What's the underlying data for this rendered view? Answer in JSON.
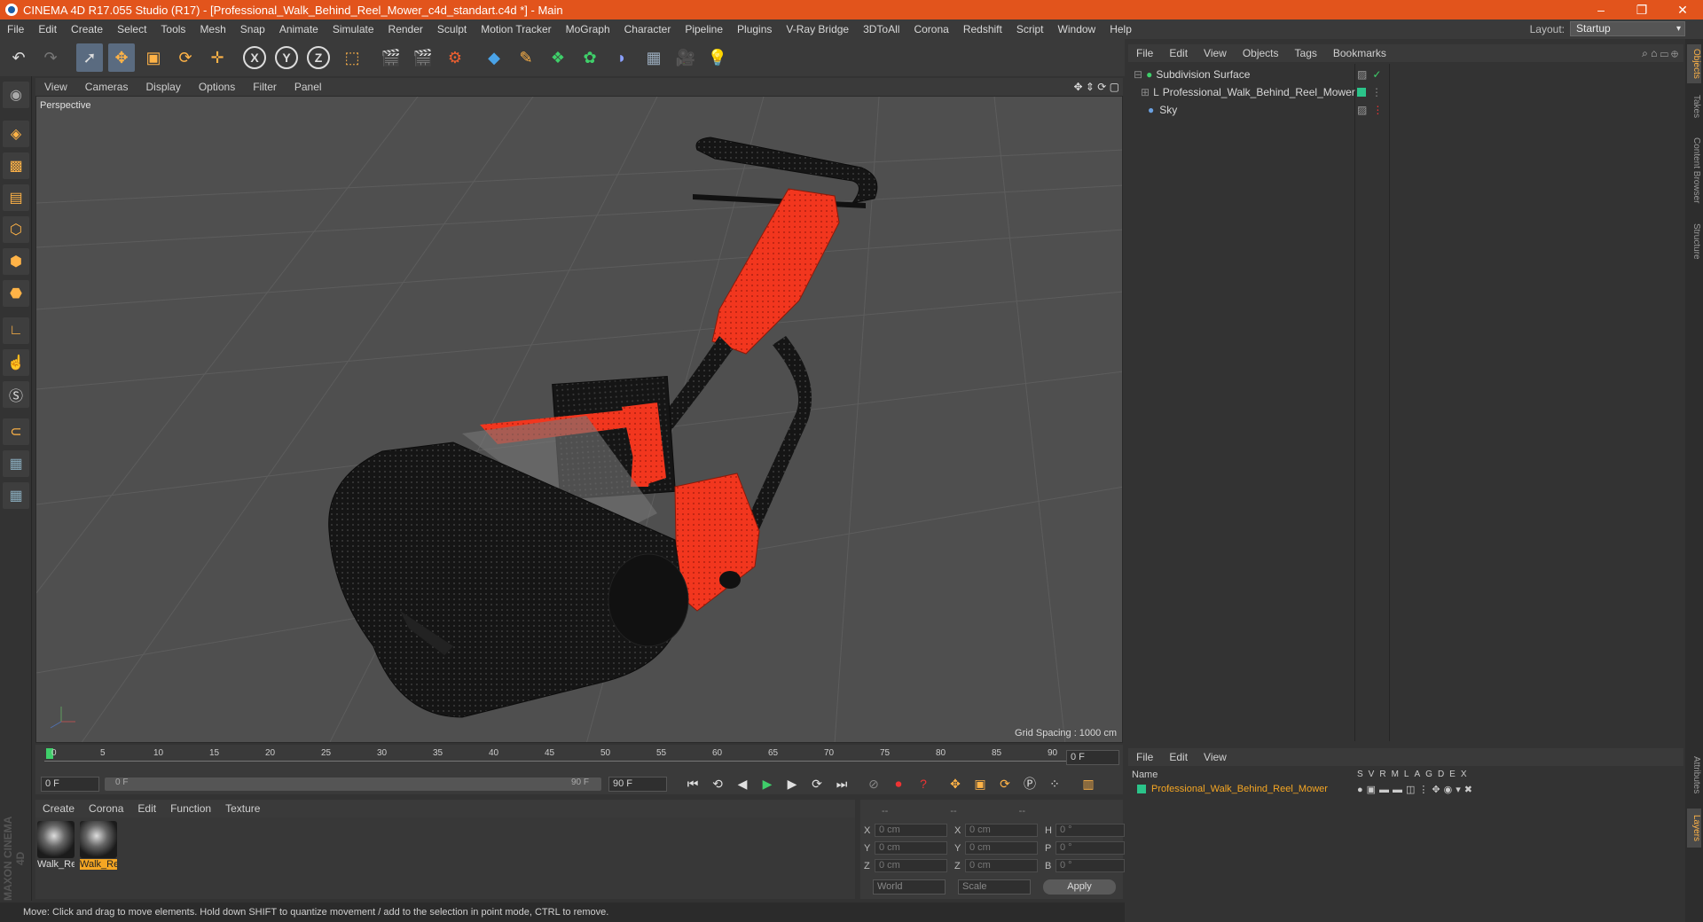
{
  "titlebar": {
    "title": "CINEMA 4D R17.055 Studio (R17) - [Professional_Walk_Behind_Reel_Mower_c4d_standart.c4d *] - Main"
  },
  "menubar": {
    "items": [
      "File",
      "Edit",
      "Create",
      "Select",
      "Tools",
      "Mesh",
      "Snap",
      "Animate",
      "Simulate",
      "Render",
      "Sculpt",
      "Motion Tracker",
      "MoGraph",
      "Character",
      "Pipeline",
      "Plugins",
      "V-Ray Bridge",
      "3DToAll",
      "Corona",
      "Redshift",
      "Script",
      "Window",
      "Help"
    ],
    "layout_label": "Layout:",
    "layout_value": "Startup"
  },
  "viewport": {
    "menu": [
      "View",
      "Cameras",
      "Display",
      "Options",
      "Filter",
      "Panel"
    ],
    "label": "Perspective",
    "grid_spacing": "Grid Spacing : 1000 cm"
  },
  "timeline": {
    "ticks": [
      "0",
      "5",
      "10",
      "15",
      "20",
      "25",
      "30",
      "35",
      "40",
      "45",
      "50",
      "55",
      "60",
      "65",
      "70",
      "75",
      "80",
      "85",
      "90"
    ],
    "current_frame": "0 F",
    "start_field": "0 F",
    "slider_start": "0 F",
    "slider_end": "90 F",
    "end_field": "90 F"
  },
  "materials": {
    "menu": [
      "Create",
      "Corona",
      "Edit",
      "Function",
      "Texture"
    ],
    "items": [
      {
        "name": "Walk_Re"
      },
      {
        "name": "Walk_Re"
      }
    ]
  },
  "coordinates": {
    "header": [
      "--",
      "--",
      "--"
    ],
    "rows": [
      {
        "a": "X",
        "av": "0 cm",
        "b": "X",
        "bv": "0 cm",
        "c": "H",
        "cv": "0 °"
      },
      {
        "a": "Y",
        "av": "0 cm",
        "b": "Y",
        "bv": "0 cm",
        "c": "P",
        "cv": "0 °"
      },
      {
        "a": "Z",
        "av": "0 cm",
        "b": "Z",
        "bv": "0 cm",
        "c": "B",
        "cv": "0 °"
      }
    ],
    "mode1": "World",
    "mode2": "Scale",
    "apply": "Apply"
  },
  "object_manager": {
    "menu": [
      "File",
      "Edit",
      "View",
      "Objects",
      "Tags",
      "Bookmarks"
    ],
    "objects": [
      {
        "name": "Subdivision Surface"
      },
      {
        "name": "Professional_Walk_Behind_Reel_Mower"
      },
      {
        "name": "Sky"
      }
    ]
  },
  "layer_manager": {
    "menu": [
      "File",
      "Edit",
      "View"
    ],
    "name_header": "Name",
    "cols": [
      "S",
      "V",
      "R",
      "M",
      "L",
      "A",
      "G",
      "D",
      "E",
      "X"
    ],
    "layer_name": "Professional_Walk_Behind_Reel_Mower",
    "layer_color": "#2bc48a"
  },
  "right_tabs": [
    "Objects",
    "Takes",
    "Content Browser",
    "Structure",
    "Attributes",
    "Layers"
  ],
  "status": "Move: Click and drag to move elements. Hold down SHIFT to quantize movement / add to the selection in point mode, CTRL to remove.",
  "brand": "MAXON CINEMA 4D",
  "colors": {
    "accent": "#e2541c",
    "selected_material": "#f5a623"
  }
}
